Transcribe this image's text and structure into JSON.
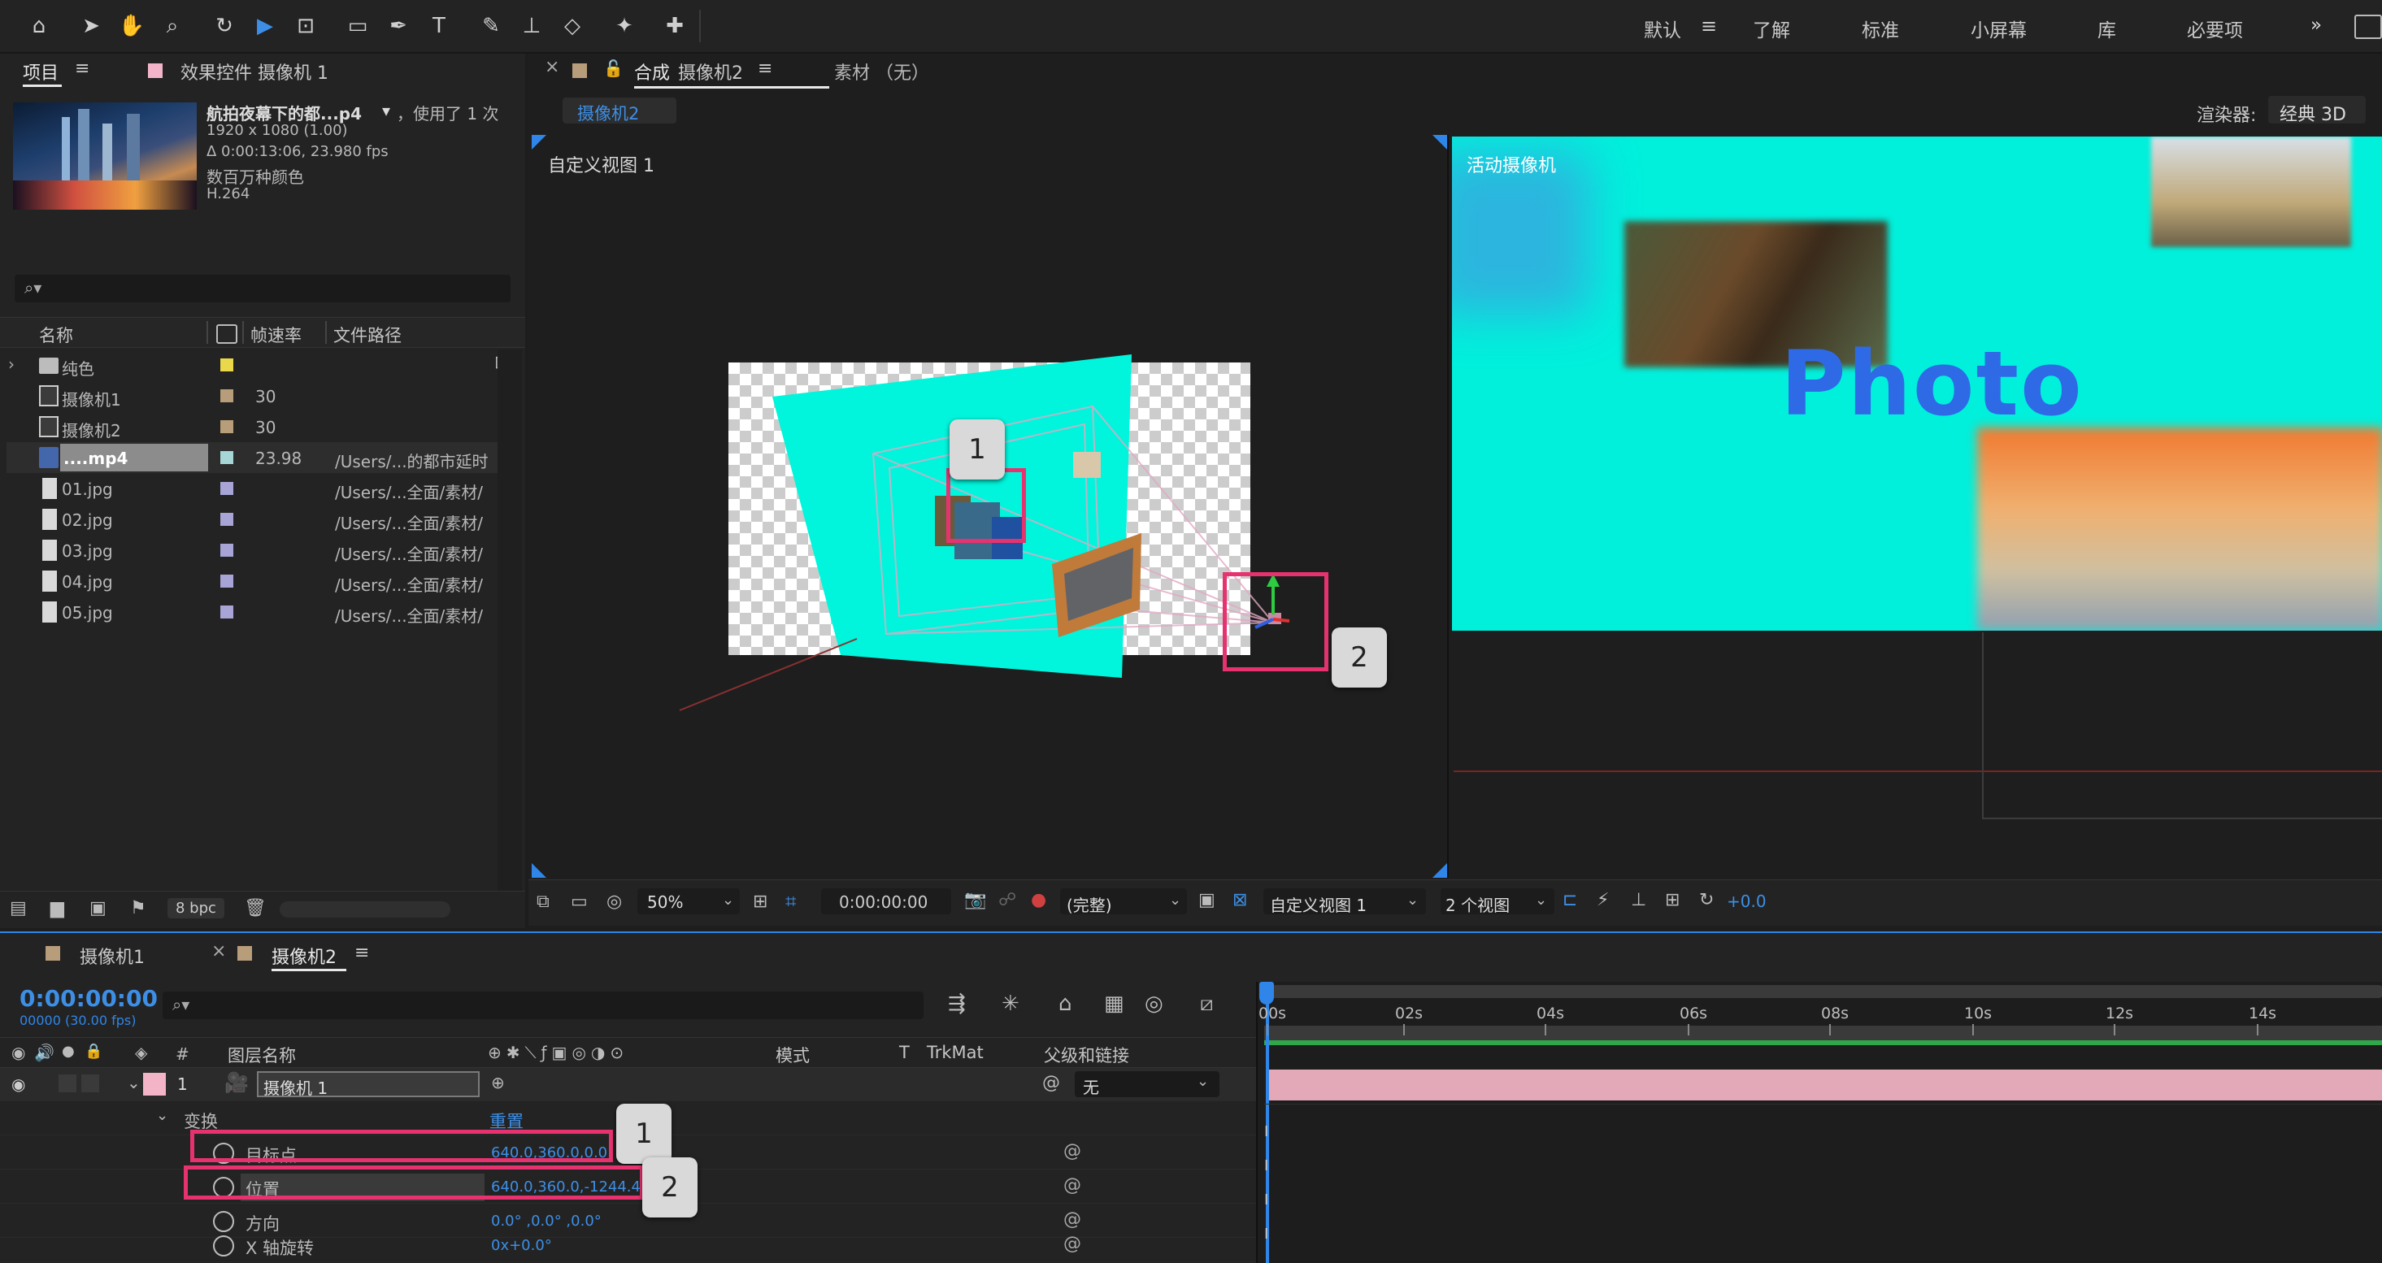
{
  "workspaces": {
    "items": [
      "默认",
      "了解",
      "标准",
      "小屏幕",
      "库",
      "必要项"
    ],
    "more": "»"
  },
  "project_panel": {
    "tab_project": "项目",
    "tab_effects": "效果控件 摄像机 1",
    "file_name": "航拍夜幕下的都...p4",
    "usage": "，使用了 1 次",
    "resolution": "1920 x 1080 (1.00)",
    "duration": "Δ 0:00:13:06, 23.980 fps",
    "colors": "数百万种颜色",
    "codec": "H.264",
    "search_placeholder": "",
    "columns": {
      "name": "名称",
      "fps": "帧速率",
      "path": "文件路径"
    },
    "items": [
      {
        "name": "纯色",
        "fps": "",
        "path": "",
        "color": "#e8d84a",
        "type": "folder"
      },
      {
        "name": "摄像机1",
        "fps": "30",
        "path": "",
        "color": "#b79d79",
        "type": "comp"
      },
      {
        "name": "摄像机2",
        "fps": "30",
        "path": "",
        "color": "#b79d79",
        "type": "comp"
      },
      {
        "name": "....mp4",
        "fps": "23.98",
        "path": "/Users/...的都市延时",
        "color": "#a7d6d6",
        "type": "video"
      },
      {
        "name": "01.jpg",
        "fps": "",
        "path": "/Users/...全面/素材/",
        "color": "#a8a5d6",
        "type": "image"
      },
      {
        "name": "02.jpg",
        "fps": "",
        "path": "/Users/...全面/素材/",
        "color": "#a8a5d6",
        "type": "image"
      },
      {
        "name": "03.jpg",
        "fps": "",
        "path": "/Users/...全面/素材/",
        "color": "#a8a5d6",
        "type": "image"
      },
      {
        "name": "04.jpg",
        "fps": "",
        "path": "/Users/...全面/素材/",
        "color": "#a8a5d6",
        "type": "image"
      },
      {
        "name": "05.jpg",
        "fps": "",
        "path": "/Users/...全面/素材/",
        "color": "#a8a5d6",
        "type": "image"
      }
    ],
    "bpc": "8 bpc"
  },
  "comp_panel": {
    "close": "×",
    "tab_prefix": "合成",
    "tab_name": "摄像机2",
    "footage_tab": "素材 （无）",
    "breadcrumb": "摄像机2",
    "renderer_label": "渲染器:",
    "renderer_value": "经典 3D",
    "left_view_label": "自定义视图 1",
    "right_view_label": "活动摄像机",
    "photo_text": "Photo",
    "callout_1": "1",
    "callout_2": "2",
    "footer": {
      "zoom": "50%",
      "timecode": "0:00:00:00",
      "quality": "(完整)",
      "view": "自定义视图 1",
      "views": "2 个视图",
      "exposure": "+0.0"
    }
  },
  "timeline": {
    "tab1": "摄像机1",
    "tab2": "摄像机2",
    "current_time": "0:00:00:00",
    "frame_info": "00000 (30.00 fps)",
    "col_num": "#",
    "col_name": "图层名称",
    "col_mode": "模式",
    "col_t": "T",
    "col_trkmat": "TrkMat",
    "col_parent": "父级和链接",
    "layer_num": "1",
    "layer_name": "摄像机 1",
    "parent_value": "无",
    "transform": "变换",
    "reset": "重置",
    "props": [
      {
        "name": "目标点",
        "value": "640.0,360.0,0.0"
      },
      {
        "name": "位置",
        "value": "640.0,360.0,-1244.4"
      },
      {
        "name": "方向",
        "value": "0.0° ,0.0° ,0.0°"
      },
      {
        "name": "X 轴旋转",
        "value": "0x+0.0°"
      }
    ],
    "ruler": [
      "00s",
      "02s",
      "04s",
      "06s",
      "08s",
      "10s",
      "12s",
      "14s"
    ],
    "callout_1": "1",
    "callout_2": "2"
  },
  "colors": {
    "accent": "#3d8fe6",
    "highlight": "#e6336f",
    "cyan": "#00f5dc",
    "photo": "#2f6ae6",
    "layer_bar": "#e3a9b8"
  }
}
